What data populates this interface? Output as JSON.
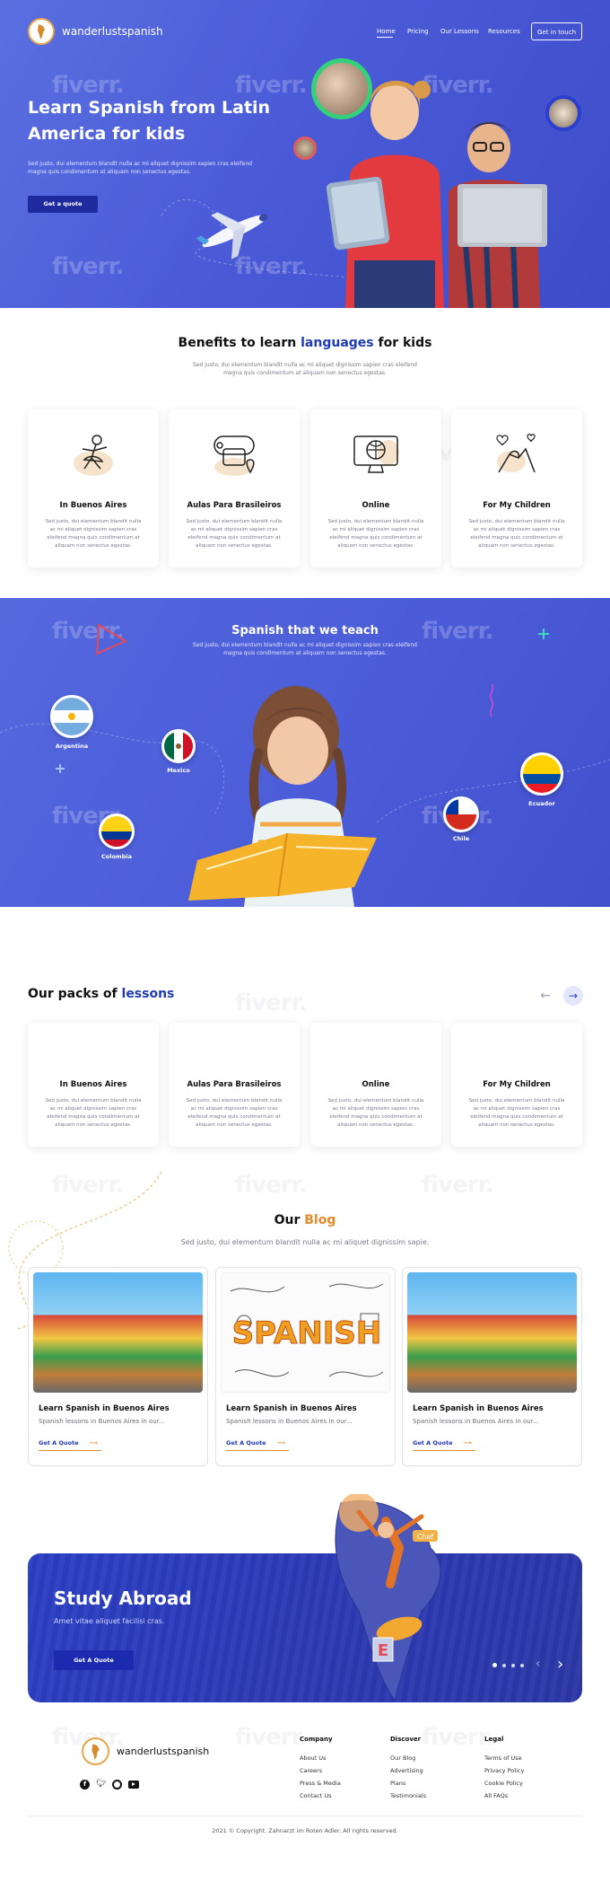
{
  "brand": {
    "name": "wanderlustspanish"
  },
  "nav": {
    "items": [
      "Home",
      "Pricing",
      "Our Lessons",
      "Resources"
    ],
    "cta": "Get in touch"
  },
  "hero": {
    "title_line1": "Learn Spanish from Latin",
    "title_line2": "America for kids",
    "subtitle_line1": "Sed justo, dui elementum blandit nulla ac mi aliquet dignissim sapien cras eleifend",
    "subtitle_line2": "magna quis condimentum at aliquam non senectus egestas.",
    "cta": "Get a quote"
  },
  "watermark": "fiverr.",
  "benefits": {
    "title_pre": "Benefits to learn ",
    "title_accent": "languages",
    "title_post": " for kids",
    "subtitle_line1": "Sed justo, dui elementum blandit nulla ac mi aliquet dignissim sapien cras eleifend",
    "subtitle_line2": "magna quis condimentum at aliquam non senectus egestas.",
    "cards": [
      {
        "icon": "ballerina-icon",
        "title": "In Buenos Aires",
        "text": [
          "Sed justo, dui elementum blandit nulla",
          "ac mi aliquet dignissim sapien cras",
          "eleifend magna quis condimentum at",
          "aliquam non senectus egestas."
        ]
      },
      {
        "icon": "travel-map-icon",
        "title": "Aulas Para Brasileiros",
        "text": [
          "Sed justo, dui elementum blandit nulla",
          "ac mi aliquet dignissim sapien cras",
          "eleifend magna quis condimentum at",
          "aliquam non senectus egestas."
        ]
      },
      {
        "icon": "online-monitor-icon",
        "title": "Online",
        "text": [
          "Sed justo, dui elementum blandit nulla",
          "ac mi aliquet dignissim sapien cras",
          "eleifend magna quis condimentum at",
          "aliquam non senectus egestas."
        ]
      },
      {
        "icon": "holding-hands-icon",
        "title": "For My Children",
        "text": [
          "Sed justo, dui elementum blandit nulla",
          "ac mi aliquet dignissim sapien cras",
          "eleifend magna quis condimentum at",
          "aliquam non senectus egestas."
        ]
      }
    ]
  },
  "spanish": {
    "title": "Spanish that we teach",
    "subtitle_line1": "Sed justo, dui elementum blandit nulla ac mi aliquet dignissim sapien cras eleifend",
    "subtitle_line2": "magna quis condimentum at aliquam non senectus egestas.",
    "countries": [
      "Argentina",
      "Mexico",
      "Colombia",
      "Chile",
      "Ecuador"
    ]
  },
  "packs": {
    "title_pre": "Our packs of ",
    "title_accent": "lessons",
    "cards": [
      {
        "title": "In Buenos Aires",
        "text": [
          "Sed justo, dui elementum blandit nulla",
          "ac mi aliquet dignissim sapien cras",
          "eleifend magna quis condimentum at",
          "aliquam non senectus egestas."
        ]
      },
      {
        "title": "Aulas Para Brasileiros",
        "text": [
          "Sed justo, dui elementum blandit nulla",
          "ac mi aliquet dignissim sapien cras",
          "eleifend magna quis condimentum at",
          "aliquam non senectus egestas."
        ]
      },
      {
        "title": "Online",
        "text": [
          "Sed justo, dui elementum blandit nulla",
          "ac mi aliquet dignissim sapien cras",
          "eleifend magna quis condimentum at",
          "aliquam non senectus egestas."
        ]
      },
      {
        "title": "For My Children",
        "text": [
          "Sed justo, dui elementum blandit nulla",
          "ac mi aliquet dignissim sapien cras",
          "eleifend magna quis condimentum at",
          "aliquam non senectus egestas."
        ]
      }
    ]
  },
  "blog": {
    "title_pre": "Our ",
    "title_accent": "Blog",
    "subtitle": "Sed justo, dui elementum blandit nulla ac mi aliquet dignissim sapie.",
    "image_word": "SPANISH",
    "posts": [
      {
        "title": "Learn Spanish in Buenos Aires",
        "text": "Spanish lessons in Buenos Aires in our...",
        "link": "Get A Quote"
      },
      {
        "title": "Learn Spanish in Buenos Aires",
        "text": "Spanish lessons in Buenos Aires in our...",
        "link": "Get A Quote"
      },
      {
        "title": "Learn Spanish in Buenos Aires",
        "text": "Spanish lessons in Buenos Aires in our...",
        "link": "Get A Quote"
      }
    ]
  },
  "study": {
    "title": "Study Abroad",
    "subtitle": "Amet vitae aliquet facilisi cras.",
    "cta": "Get A Quote",
    "badge": "Chef"
  },
  "footer": {
    "columns": [
      {
        "heading": "Company",
        "links": [
          "About Us",
          "Careers",
          "Press & Media",
          "Contact Us"
        ]
      },
      {
        "heading": "Discover",
        "links": [
          "Our Blog",
          "Advertising",
          "Plans",
          "Testimonials"
        ]
      },
      {
        "heading": "Legal",
        "links": [
          "Terms of Use",
          "Privacy Policy",
          "Cookie Policy",
          "All FAQs"
        ]
      }
    ],
    "copyright": "2021 © Copyright. Zahnarzt im Roten Adler. All rights reserved."
  },
  "colors": {
    "primary": "#4b5bd8",
    "dark_blue": "#1f2a9e",
    "accent_blue": "#1e3bb5",
    "accent_orange": "#e38a2a"
  }
}
